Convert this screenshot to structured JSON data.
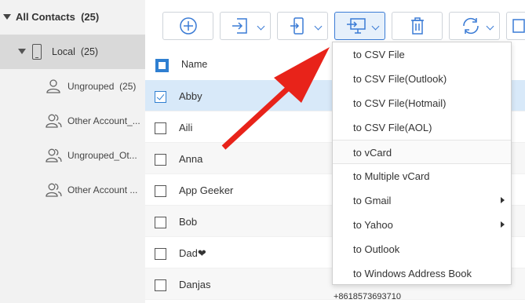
{
  "sidebar": {
    "all_contacts": "All Contacts",
    "all_count": "(25)",
    "local": "Local",
    "local_count": "(25)",
    "items": [
      {
        "label": "Ungrouped",
        "count": "(25)"
      },
      {
        "label": "Other Account_...",
        "count": ""
      },
      {
        "label": "Ungrouped_Ot...",
        "count": ""
      },
      {
        "label": "Other Account ...",
        "count": ""
      }
    ]
  },
  "toolbar": {
    "buttons": [
      "add-contact",
      "import",
      "export-to-device",
      "export-to-computer",
      "delete",
      "refresh"
    ]
  },
  "list": {
    "header_name": "Name",
    "rows": [
      {
        "name": "Abby",
        "selected": true
      },
      {
        "name": "Aili",
        "selected": false
      },
      {
        "name": "Anna",
        "selected": false
      },
      {
        "name": "App Geeker",
        "selected": false
      },
      {
        "name": "Bob",
        "selected": false
      },
      {
        "name": "Dad❤",
        "selected": false
      },
      {
        "name": "Danjas",
        "selected": false
      }
    ],
    "partial_phone": "+8618573693710"
  },
  "export_menu": {
    "items": [
      {
        "label": "to CSV File"
      },
      {
        "label": "to CSV File(Outlook)"
      },
      {
        "label": "to CSV File(Hotmail)"
      },
      {
        "label": "to CSV File(AOL)"
      },
      {
        "label": "to vCard"
      },
      {
        "label": "to Multiple vCard"
      },
      {
        "label": "to Gmail",
        "submenu": true
      },
      {
        "label": "to Yahoo",
        "submenu": true
      },
      {
        "label": "to Outlook"
      },
      {
        "label": "to Windows Address Book"
      }
    ]
  },
  "colors": {
    "accent": "#2f7fd1",
    "arrow": "#e8231a",
    "selected_row": "#d8e9f9"
  }
}
